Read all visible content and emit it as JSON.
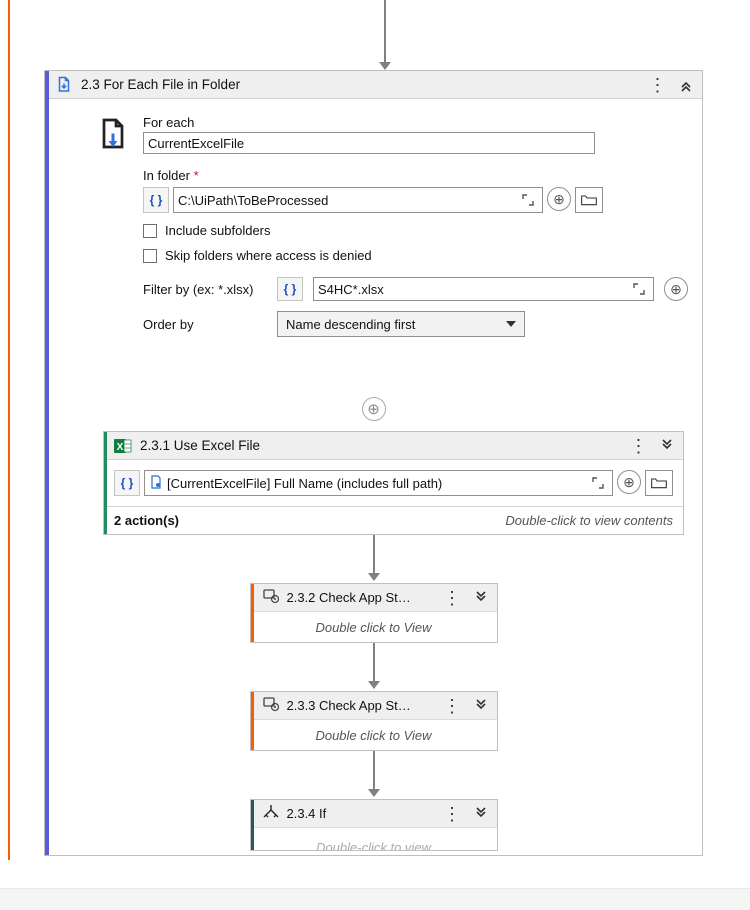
{
  "activity": {
    "number": "2.3",
    "title": "2.3 For Each File in Folder",
    "forEachLabel": "For each",
    "forEachValue": "CurrentExcelFile",
    "inFolderLabel": "In folder",
    "inFolderValue": "C:\\UiPath\\ToBeProcessed",
    "includeSubfoldersLabel": "Include subfolders",
    "includeSubfoldersChecked": false,
    "skipDeniedLabel": "Skip folders where access is denied",
    "skipDeniedChecked": false,
    "filterLabel": "Filter by (ex: *.xlsx)",
    "filterValue": "S4HC*.xlsx",
    "orderByLabel": "Order by",
    "orderByValue": "Name descending first"
  },
  "useExcel": {
    "title": "2.3.1 Use Excel File",
    "fileExpr": "[CurrentExcelFile] Full Name (includes full path)",
    "actionsText": "2 action(s)",
    "hint": "Double-click to view contents"
  },
  "mini1": {
    "title": "2.3.2 Check App St…",
    "body": "Double click to View"
  },
  "mini2": {
    "title": "2.3.3 Check App St…",
    "body": "Double click to View"
  },
  "mini3": {
    "title": "2.3.4 If",
    "body": "Double-click to view"
  },
  "icons": {
    "braces": "{ }",
    "expand": "⌐"
  }
}
